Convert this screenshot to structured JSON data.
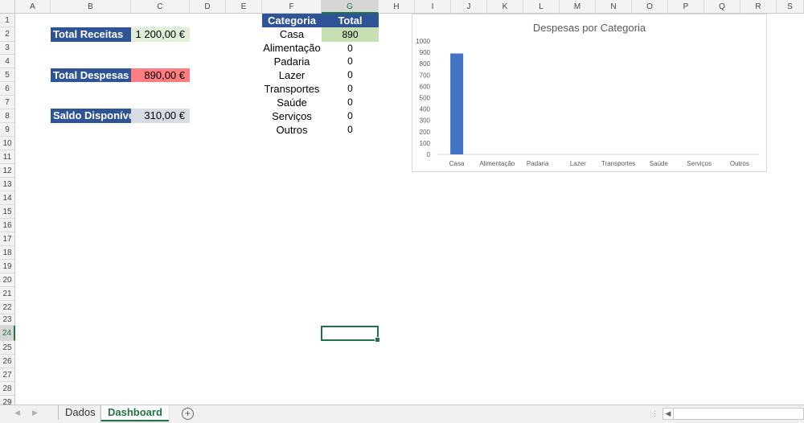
{
  "columns": [
    "A",
    "B",
    "C",
    "D",
    "E",
    "F",
    "G",
    "H",
    "I",
    "J",
    "K",
    "L",
    "M",
    "N",
    "O",
    "P",
    "Q",
    "R",
    "S"
  ],
  "rows": [
    "1",
    "2",
    "3",
    "4",
    "5",
    "6",
    "7",
    "8",
    "9",
    "10",
    "11",
    "12",
    "13",
    "14",
    "15",
    "16",
    "17",
    "18",
    "19",
    "20",
    "21",
    "22",
    "23",
    "24",
    "25",
    "26",
    "27",
    "28",
    "29"
  ],
  "selected": {
    "column": "G",
    "row": "24"
  },
  "summary": {
    "receitas": {
      "label": "Total Receitas",
      "value": "1 200,00 €"
    },
    "despesas": {
      "label": "Total Despesas",
      "value": "890,00 €"
    },
    "saldo": {
      "label": "Saldo Disponível",
      "value": "310,00 €"
    }
  },
  "table": {
    "headers": {
      "categoria": "Categoria",
      "total": "Total"
    },
    "rows": [
      {
        "categoria": "Casa",
        "total": "890"
      },
      {
        "categoria": "Alimentação",
        "total": "0"
      },
      {
        "categoria": "Padaria",
        "total": "0"
      },
      {
        "categoria": "Lazer",
        "total": "0"
      },
      {
        "categoria": "Transportes",
        "total": "0"
      },
      {
        "categoria": "Saúde",
        "total": "0"
      },
      {
        "categoria": "Serviços",
        "total": "0"
      },
      {
        "categoria": "Outros",
        "total": "0"
      }
    ]
  },
  "colors": {
    "label_bg": "#2f5496",
    "receitas_bg": "#e2efda",
    "despesas_bg": "#ff7c80",
    "saldo_bg": "#d6dce4",
    "highlight_total": "#c6e0b4",
    "bar": "#4472c4",
    "accent": "#217346"
  },
  "chart_data": {
    "type": "bar",
    "title": "Despesas por Categoria",
    "categories": [
      "Casa",
      "Alimentação",
      "Padaria",
      "Lazer",
      "Transportes",
      "Saúde",
      "Serviços",
      "Outros"
    ],
    "values": [
      890,
      0,
      0,
      0,
      0,
      0,
      0,
      0
    ],
    "ylim": [
      0,
      1000
    ],
    "yticks": [
      0,
      100,
      200,
      300,
      400,
      500,
      600,
      700,
      800,
      900,
      1000
    ],
    "grid": false,
    "legend": "none"
  },
  "tabs": [
    {
      "label": "Dados",
      "active": false
    },
    {
      "label": "Dashboard",
      "active": true
    }
  ],
  "icons": {
    "add_sheet": "plus-circle-icon",
    "nav_prev": "triangle-left-icon",
    "nav_next": "triangle-right-icon"
  }
}
